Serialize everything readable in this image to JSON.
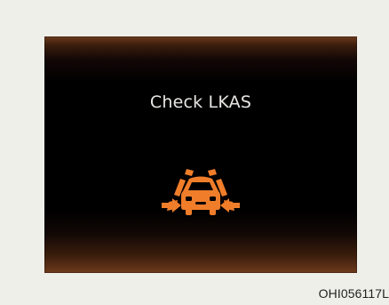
{
  "display": {
    "message": "Check LKAS",
    "icon": "lkas-warning-icon",
    "icon_color": "#f07d2a",
    "background_color": "#000000",
    "text_color": "#e8e6e3"
  },
  "caption": {
    "code": "OHI056117L"
  }
}
